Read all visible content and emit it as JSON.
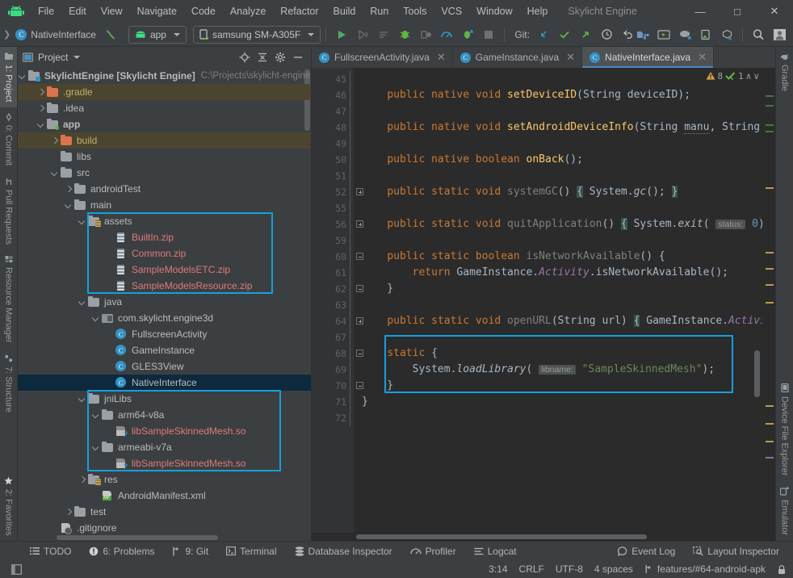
{
  "window": {
    "title": "Skylicht Engine",
    "minimize": "—",
    "maximize": "□",
    "close": "✕"
  },
  "menubar": {
    "items": [
      "File",
      "Edit",
      "View",
      "Navigate",
      "Code",
      "Analyze",
      "Refactor",
      "Build",
      "Run",
      "Tools",
      "VCS",
      "Window",
      "Help"
    ]
  },
  "toolbar": {
    "breadcrumb_class": "NativeInterface",
    "module_combo": "app",
    "device_combo": "samsung SM-A305F",
    "git_label": "Git:",
    "icons": [
      "hammer-icon",
      "run-icon",
      "apply-changes-icon",
      "apply-code-changes-icon",
      "debug-icon",
      "attach-debugger-icon",
      "profiler-icon",
      "run-with-coverage-icon",
      "stop-icon",
      "git-update-icon",
      "git-commit-icon",
      "git-push-icon",
      "history-icon",
      "undo-icon",
      "avd-manager-icon",
      "sdk-manager-icon",
      "layout-editor-icon",
      "device-manager-icon",
      "device-file-icon",
      "apk-analyzer-icon",
      "search-icon",
      "account-icon"
    ]
  },
  "left_strip": {
    "items": [
      "1: Project",
      "0: Commit",
      "Pull Requests",
      "Resource Manager",
      "7: Structure",
      "2: Favorites"
    ],
    "active": "1: Project"
  },
  "right_strip": {
    "items": [
      "Gradle",
      "Device File Explorer",
      "Emulator"
    ]
  },
  "project_panel": {
    "title": "Project",
    "buttons": [
      "locate-icon",
      "collapse-all-icon",
      "settings-icon",
      "hide-icon"
    ],
    "tree": [
      {
        "depth": 0,
        "arrow": "down",
        "icon": "project-folder-icon",
        "label": "SkylichtEngine [Skylicht Engine]",
        "sub": "C:\\Projects\\skylicht-engine",
        "bold": true
      },
      {
        "depth": 1,
        "arrow": "right",
        "icon": "folder-orange-icon",
        "label": ".gradle",
        "state": "hl",
        "color": "yellow"
      },
      {
        "depth": 1,
        "arrow": "right",
        "icon": "folder-gray-icon",
        "label": ".idea"
      },
      {
        "depth": 1,
        "arrow": "down",
        "icon": "folder-module-icon",
        "label": "app",
        "bold": true
      },
      {
        "depth": 2,
        "arrow": "right",
        "icon": "folder-orange-icon",
        "label": "build",
        "state": "hl",
        "color": "yellow"
      },
      {
        "depth": 2,
        "arrow": "none",
        "icon": "folder-gray-icon",
        "label": "libs"
      },
      {
        "depth": 2,
        "arrow": "down",
        "icon": "folder-gray-icon",
        "label": "src"
      },
      {
        "depth": 3,
        "arrow": "right",
        "icon": "folder-gray-icon",
        "label": "androidTest"
      },
      {
        "depth": 3,
        "arrow": "down",
        "icon": "folder-gray-icon",
        "label": "main"
      },
      {
        "depth": 4,
        "arrow": "down",
        "icon": "folder-resource-icon",
        "label": "assets"
      },
      {
        "depth": 6,
        "arrow": "none",
        "icon": "zip-file-icon",
        "label": "BuiltIn.zip",
        "color": "red"
      },
      {
        "depth": 6,
        "arrow": "none",
        "icon": "zip-file-icon",
        "label": "Common.zip",
        "color": "red"
      },
      {
        "depth": 6,
        "arrow": "none",
        "icon": "zip-file-icon",
        "label": "SampleModelsETC.zip",
        "color": "red"
      },
      {
        "depth": 6,
        "arrow": "none",
        "icon": "zip-file-icon",
        "label": "SampleModelsResource.zip",
        "color": "red"
      },
      {
        "depth": 4,
        "arrow": "down",
        "icon": "folder-gray-icon",
        "label": "java"
      },
      {
        "depth": 5,
        "arrow": "down",
        "icon": "package-icon",
        "label": "com.skylicht.engine3d"
      },
      {
        "depth": 6,
        "arrow": "none",
        "icon": "java-class-icon",
        "label": "FullscreenActivity"
      },
      {
        "depth": 6,
        "arrow": "none",
        "icon": "java-class-icon",
        "label": "GameInstance"
      },
      {
        "depth": 6,
        "arrow": "none",
        "icon": "java-class-icon",
        "label": "GLES3View"
      },
      {
        "depth": 6,
        "arrow": "none",
        "icon": "java-class-icon",
        "label": "NativeInterface",
        "state": "sel"
      },
      {
        "depth": 4,
        "arrow": "down",
        "icon": "folder-gray-icon",
        "label": "jniLibs"
      },
      {
        "depth": 5,
        "arrow": "down",
        "icon": "folder-gray-icon",
        "label": "arm64-v8a"
      },
      {
        "depth": 6,
        "arrow": "none",
        "icon": "so-file-icon",
        "label": "libSampleSkinnedMesh.so",
        "color": "red"
      },
      {
        "depth": 5,
        "arrow": "down",
        "icon": "folder-gray-icon",
        "label": "armeabi-v7a"
      },
      {
        "depth": 6,
        "arrow": "none",
        "icon": "so-file-icon",
        "label": "libSampleSkinnedMesh.so",
        "color": "red"
      },
      {
        "depth": 4,
        "arrow": "right",
        "icon": "folder-resource-icon",
        "label": "res"
      },
      {
        "depth": 5,
        "arrow": "none",
        "icon": "manifest-file-icon",
        "label": "AndroidManifest.xml"
      },
      {
        "depth": 3,
        "arrow": "right",
        "icon": "folder-gray-icon",
        "label": "test"
      },
      {
        "depth": 2,
        "arrow": "none",
        "icon": "gitignore-file-icon",
        "label": ".gitignore"
      }
    ]
  },
  "editor": {
    "tabs": [
      {
        "label": "FullscreenActivity.java",
        "active": false
      },
      {
        "label": "GameInstance.java",
        "active": false
      },
      {
        "label": "NativeInterface.java",
        "active": true
      }
    ],
    "inspection": {
      "warning_count": "8",
      "ok_count": "1",
      "up": "∧",
      "down": "∨"
    },
    "line_numbers": [
      45,
      46,
      47,
      48,
      49,
      50,
      51,
      52,
      55,
      56,
      59,
      60,
      61,
      62,
      63,
      64,
      67,
      68,
      69,
      70,
      71,
      72
    ],
    "code_lines": [
      "",
      "    public native void setDeviceID(String deviceID);",
      "",
      "    public native void setAndroidDeviceInfo(String manu, String",
      "",
      "    public native boolean onBack();",
      "",
      "    public static void systemGC() { System.gc(); }",
      "",
      "    public static void quitApplication() { System.exit( status: 0);",
      "",
      "    public static boolean isNetworkAvailable() {",
      "        return GameInstance.Activity.isNetworkAvailable();",
      "    }",
      "",
      "    public static void openURL(String url) { GameInstance.Activi",
      "",
      "    static {",
      "        System.loadLibrary( libname: \"SampleSkinnedMesh\");",
      "    }",
      "}",
      ""
    ],
    "param_hints": [
      "status:",
      "libname:"
    ],
    "string_literal": "\"SampleSkinnedMesh\""
  },
  "bottom_bar": {
    "items": [
      {
        "label": "TODO",
        "icon": "todo-icon",
        "mnemonic": ""
      },
      {
        "label": "6: Problems",
        "icon": "problems-icon",
        "mnemonic": "6"
      },
      {
        "label": "9: Git",
        "icon": "git-icon",
        "mnemonic": "9"
      },
      {
        "label": "Terminal",
        "icon": "terminal-icon",
        "mnemonic": ""
      },
      {
        "label": "Database Inspector",
        "icon": "database-icon",
        "mnemonic": ""
      },
      {
        "label": "Profiler",
        "icon": "profiler-icon",
        "mnemonic": ""
      },
      {
        "label": "Logcat",
        "icon": "logcat-icon",
        "mnemonic": ""
      }
    ],
    "right_items": [
      {
        "label": "Event Log",
        "icon": "event-log-icon"
      },
      {
        "label": "Layout Inspector",
        "icon": "layout-inspector-icon"
      }
    ]
  },
  "status_bar": {
    "caret_position": "3:14",
    "line_separator": "CRLF",
    "encoding": "UTF-8",
    "indent": "4 spaces",
    "branch": "features/#64-android-apk",
    "lock_icon": "lock-icon"
  },
  "colors": {
    "accent_blue": "#14a0e0",
    "selection": "#0d293e",
    "highlight_row": "#4b4530",
    "editor_bg": "#2b2b2b",
    "panel_bg": "#3c3f41",
    "keyword": "#cc7832",
    "method": "#ffc66d",
    "string": "#6a8759",
    "number": "#6897bb",
    "field": "#9876aa",
    "file_red": "#dd7a7a",
    "folder_yellow": "#c4b06a"
  }
}
